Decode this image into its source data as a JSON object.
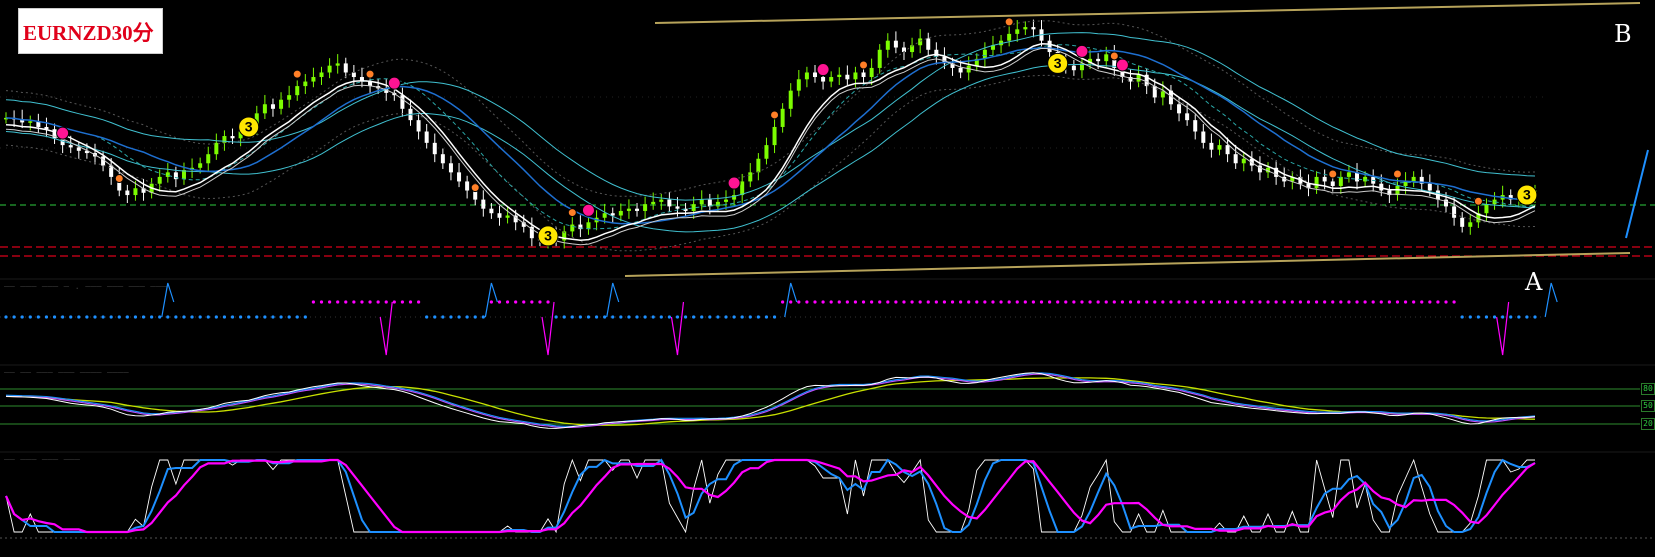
{
  "chart_title": "EURNZD30分",
  "point_labels": {
    "a": "A",
    "b": "B"
  },
  "pane_titles": {
    "ind1": "—— ——— ——— — .  ——— ——— ——— ———",
    "ind2": "—— —— ——— ——— ———— ————",
    "ind3": "—— ——— ——— ———"
  },
  "level_labels": [
    "80",
    "50",
    "20"
  ],
  "colors": {
    "background": "#000000",
    "bull_candle": "#7CFC00",
    "bear_candle": "#ffffff",
    "trendline": "#b7a35a",
    "support_red": "#d9001b",
    "level_green": "#2ecc40",
    "signal_magenta": "#ff00ff",
    "signal_blue": "#1e90ff",
    "marker_yellow": "#ffe600",
    "marker_orange": "#ff7f27",
    "marker_pink": "#ff1493"
  },
  "chart_data": {
    "type": "candlestick",
    "close": [
      0.56,
      0.555,
      0.54,
      0.545,
      0.52,
      0.51,
      0.47,
      0.44,
      0.43,
      0.415,
      0.405,
      0.39,
      0.35,
      0.3,
      0.24,
      0.22,
      0.25,
      0.23,
      0.27,
      0.3,
      0.32,
      0.29,
      0.33,
      0.34,
      0.36,
      0.4,
      0.45,
      0.48,
      0.47,
      0.5,
      0.52,
      0.58,
      0.62,
      0.6,
      0.64,
      0.66,
      0.7,
      0.72,
      0.74,
      0.76,
      0.79,
      0.8,
      0.76,
      0.74,
      0.72,
      0.7,
      0.69,
      0.67,
      0.66,
      0.6,
      0.55,
      0.5,
      0.45,
      0.4,
      0.36,
      0.32,
      0.28,
      0.24,
      0.2,
      0.16,
      0.14,
      0.12,
      0.13,
      0.1,
      0.08,
      0.03,
      0.02,
      0.04,
      0.02,
      0.06,
      0.09,
      0.07,
      0.1,
      0.12,
      0.14,
      0.13,
      0.15,
      0.16,
      0.15,
      0.18,
      0.19,
      0.2,
      0.17,
      0.16,
      0.15,
      0.18,
      0.2,
      0.17,
      0.19,
      0.2,
      0.22,
      0.28,
      0.32,
      0.38,
      0.44,
      0.52,
      0.6,
      0.68,
      0.73,
      0.76,
      0.74,
      0.72,
      0.74,
      0.75,
      0.73,
      0.76,
      0.74,
      0.78,
      0.86,
      0.9,
      0.87,
      0.85,
      0.88,
      0.91,
      0.86,
      0.83,
      0.8,
      0.78,
      0.76,
      0.79,
      0.82,
      0.86,
      0.88,
      0.9,
      0.93,
      0.95,
      0.96,
      0.95,
      0.9,
      0.85,
      0.8,
      0.79,
      0.77,
      0.8,
      0.82,
      0.81,
      0.84,
      0.78,
      0.74,
      0.72,
      0.75,
      0.7,
      0.65,
      0.68,
      0.62,
      0.58,
      0.55,
      0.5,
      0.45,
      0.42,
      0.44,
      0.4,
      0.36,
      0.38,
      0.35,
      0.32,
      0.34,
      0.3,
      0.28,
      0.3,
      0.27,
      0.25,
      0.3,
      0.28,
      0.26,
      0.3,
      0.32,
      0.28,
      0.3,
      0.27,
      0.24,
      0.22,
      0.26,
      0.28,
      0.3,
      0.27,
      0.24,
      0.2,
      0.17,
      0.12,
      0.08,
      0.1,
      0.14,
      0.18,
      0.2,
      0.22,
      0.2,
      0.21,
      0.22,
      0.24
    ],
    "bands": {
      "upper": 0.98,
      "lower": 0.02
    }
  }
}
